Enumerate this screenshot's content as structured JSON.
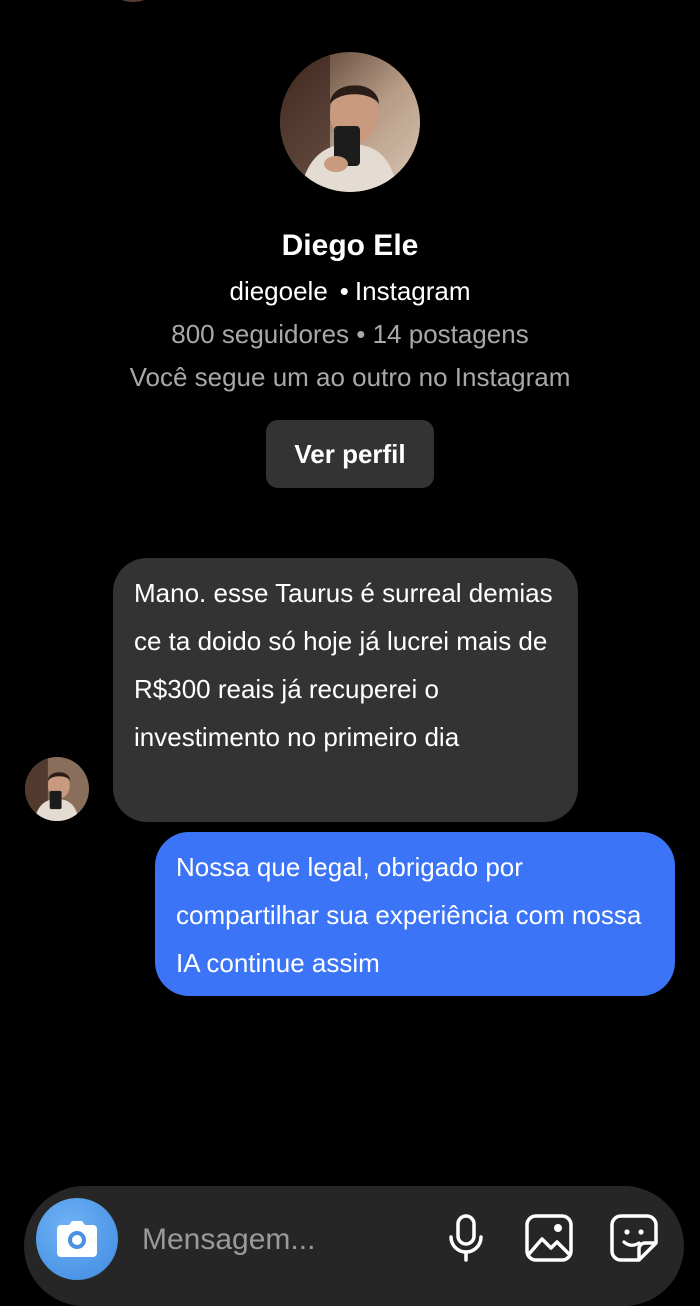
{
  "profile": {
    "name": "Diego Ele",
    "username": "diegoele",
    "separator": "•",
    "platform": "Instagram",
    "stats": "800 seguidores • 14 postagens",
    "mutual_follow": "Você segue um ao outro no Instagram",
    "view_profile_label": "Ver perfil"
  },
  "messages": [
    {
      "direction": "incoming",
      "text": "Mano. esse Taurus é surreal demias ce ta doido só hoje já lucrei mais de R$300 reais já recuperei o investimento no primeiro dia"
    },
    {
      "direction": "outgoing",
      "text": "Nossa que legal, obrigado por compartilhar sua experiência com nossa IA continue assim"
    }
  ],
  "composer": {
    "placeholder": "Mensagem...",
    "icons": [
      "camera-icon",
      "microphone-icon",
      "image-icon",
      "sticker-icon"
    ]
  },
  "colors": {
    "background": "#000000",
    "incoming_bubble": "#333333",
    "outgoing_bubble": "#3b74f6",
    "secondary_text": "#a8a8a8",
    "camera_button": "#4a90e2"
  }
}
